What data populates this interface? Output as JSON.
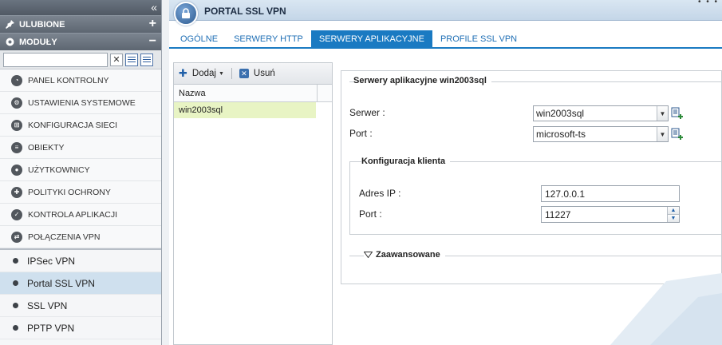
{
  "sidebar": {
    "favorites_label": "ULUBIONE",
    "modules_label": "MODUŁY",
    "filter_value": "",
    "modules": [
      {
        "label": "PANEL KONTROLNY",
        "icon": "dashboard-icon"
      },
      {
        "label": "USTAWIENIA SYSTEMOWE",
        "icon": "settings-icon"
      },
      {
        "label": "KONFIGURACJA SIECI",
        "icon": "network-icon"
      },
      {
        "label": "OBIEKTY",
        "icon": "database-icon"
      },
      {
        "label": "UŻYTKOWNICY",
        "icon": "user-icon"
      },
      {
        "label": "POLITYKI OCHRONY",
        "icon": "policy-icon"
      },
      {
        "label": "KONTROLA APLIKACJI",
        "icon": "shield-icon"
      },
      {
        "label": "POŁĄCZENIA VPN",
        "icon": "vpn-icon"
      }
    ],
    "vpn_items": [
      {
        "label": "IPSec VPN",
        "active": false
      },
      {
        "label": "Portal SSL VPN",
        "active": true
      },
      {
        "label": "SSL VPN",
        "active": false
      },
      {
        "label": "PPTP VPN",
        "active": false
      }
    ]
  },
  "header": {
    "title": "PORTAL SSL VPN"
  },
  "tabs": [
    {
      "label": "OGÓLNE",
      "active": false
    },
    {
      "label": "SERWERY HTTP",
      "active": false
    },
    {
      "label": "SERWERY APLIKACYJNE",
      "active": true
    },
    {
      "label": "PROFILE SSL VPN",
      "active": false
    }
  ],
  "list": {
    "add_label": "Dodaj",
    "remove_label": "Usuń",
    "column_name": "Nazwa",
    "rows": [
      "win2003sql"
    ]
  },
  "form": {
    "legend": "Serwery aplikacyjne win2003sql",
    "server_label": "Serwer :",
    "server_value": "win2003sql",
    "port_label": "Port :",
    "port_value": "microsoft-ts",
    "client_legend": "Konfiguracja klienta",
    "ip_label": "Adres IP :",
    "ip_value": "127.0.0.1",
    "client_port_label": "Port :",
    "client_port_value": "11227",
    "advanced_label": "Zaawansowane"
  },
  "colors": {
    "accent": "#1a7ac2",
    "selected_row": "#e8f4c4",
    "active_nav": "#cfe0ee"
  }
}
